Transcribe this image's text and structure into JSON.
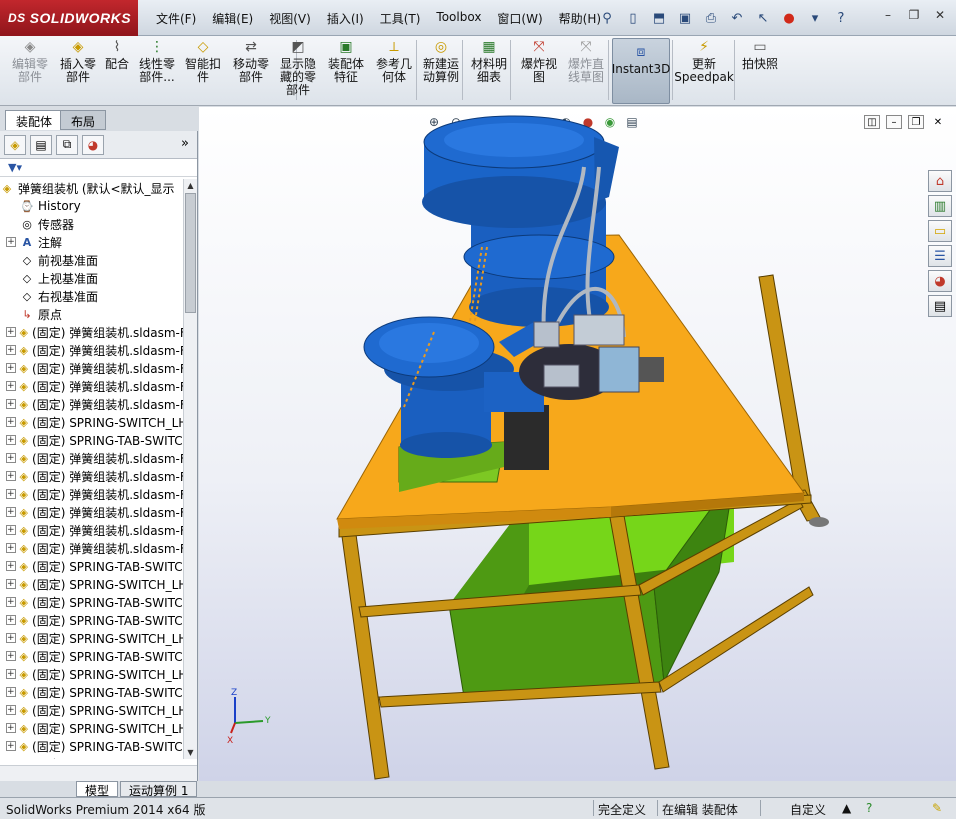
{
  "app": {
    "logo_prefix": "DS",
    "logo": "SOLIDWORKS"
  },
  "menu": [
    "文件(F)",
    "编辑(E)",
    "视图(V)",
    "插入(I)",
    "工具(T)",
    "Toolbox",
    "窗口(W)",
    "帮助(H)"
  ],
  "quick_toolbar": [
    "pin-icon",
    "new-document-icon",
    "open-folder-icon",
    "save-icon",
    "print-icon",
    "undo-icon",
    "select-arrow-icon",
    "rebuild-traffic-light-icon",
    "options-gear-icon",
    "help-icon"
  ],
  "window_controls": [
    "minimize-icon",
    "restore-icon",
    "close-icon"
  ],
  "ribbon": [
    {
      "id": "edit-component",
      "label": "编辑零\n部件",
      "enabled": false
    },
    {
      "id": "insert-component",
      "label": "插入零\n部件",
      "enabled": true
    },
    {
      "id": "mate",
      "label": "配合",
      "enabled": true
    },
    {
      "id": "linear-pattern",
      "label": "线性零\n部件...",
      "enabled": true
    },
    {
      "id": "smart-fasteners",
      "label": "智能扣\n件",
      "enabled": true
    },
    {
      "id": "move-component",
      "label": "移动零\n部件",
      "enabled": true
    },
    {
      "id": "show-hidden",
      "label": "显示隐\n藏的零\n部件",
      "enabled": true
    },
    {
      "id": "assembly-features",
      "label": "装配体\n特征",
      "enabled": true
    },
    {
      "id": "reference-geometry",
      "label": "参考几\n何体",
      "enabled": true
    },
    {
      "id": "new-motion-study",
      "label": "新建运\n动算例",
      "enabled": true
    },
    {
      "id": "bom",
      "label": "材料明\n细表",
      "enabled": true
    },
    {
      "id": "exploded-view",
      "label": "爆炸视\n图",
      "enabled": true
    },
    {
      "id": "explode-line-sketch",
      "label": "爆炸直\n线草图",
      "enabled": false
    },
    {
      "id": "instant3d",
      "label": "Instant3D",
      "enabled": true
    },
    {
      "id": "update-speedpak",
      "label": "更新\nSpeedpak",
      "enabled": true
    },
    {
      "id": "snapshot",
      "label": "拍快照",
      "enabled": true
    }
  ],
  "fm_tabs": {
    "assembly": "装配体",
    "layout": "布局"
  },
  "tree": {
    "root": "弹簧组装机 (默认<默认_显示",
    "items": [
      {
        "label": "History",
        "icon": "history-icon",
        "expand": false
      },
      {
        "label": "传感器",
        "icon": "sensor-icon",
        "expand": false
      },
      {
        "label": "注解",
        "icon": "annotation-icon",
        "expand": true
      },
      {
        "label": "前视基准面",
        "icon": "plane-icon",
        "expand": false
      },
      {
        "label": "上视基准面",
        "icon": "plane-icon",
        "expand": false
      },
      {
        "label": "右视基准面",
        "icon": "plane-icon",
        "expand": false
      },
      {
        "label": "原点",
        "icon": "origin-icon",
        "expand": false
      },
      {
        "label": "(固定) 弹簧组装机.sldasm-F",
        "icon": "subassembly-icon",
        "expand": true
      },
      {
        "label": "(固定) 弹簧组装机.sldasm-F",
        "icon": "subassembly-icon",
        "expand": true
      },
      {
        "label": "(固定) 弹簧组装机.sldasm-F",
        "icon": "subassembly-icon",
        "expand": true
      },
      {
        "label": "(固定) 弹簧组装机.sldasm-F",
        "icon": "subassembly-icon",
        "expand": true
      },
      {
        "label": "(固定) 弹簧组装机.sldasm-F",
        "icon": "subassembly-icon",
        "expand": true
      },
      {
        "label": "(固定) SPRING-SWITCH_LH_",
        "icon": "subassembly-icon",
        "expand": true
      },
      {
        "label": "(固定) SPRING-TAB-SWITCH",
        "icon": "subassembly-icon",
        "expand": true
      },
      {
        "label": "(固定) 弹簧组装机.sldasm-F",
        "icon": "subassembly-icon",
        "expand": true
      },
      {
        "label": "(固定) 弹簧组装机.sldasm-F",
        "icon": "subassembly-icon",
        "expand": true
      },
      {
        "label": "(固定) 弹簧组装机.sldasm-F",
        "icon": "subassembly-icon",
        "expand": true
      },
      {
        "label": "(固定) 弹簧组装机.sldasm-F",
        "icon": "subassembly-icon",
        "expand": true
      },
      {
        "label": "(固定) 弹簧组装机.sldasm-F",
        "icon": "subassembly-icon",
        "expand": true
      },
      {
        "label": "(固定) 弹簧组装机.sldasm-F",
        "icon": "subassembly-icon",
        "expand": true
      },
      {
        "label": "(固定) SPRING-TAB-SWITCH",
        "icon": "subassembly-icon",
        "expand": true
      },
      {
        "label": "(固定) SPRING-SWITCH_LH_",
        "icon": "subassembly-icon",
        "expand": true
      },
      {
        "label": "(固定) SPRING-TAB-SWITCH",
        "icon": "subassembly-icon",
        "expand": true
      },
      {
        "label": "(固定) SPRING-TAB-SWITCH",
        "icon": "subassembly-icon",
        "expand": true
      },
      {
        "label": "(固定) SPRING-SWITCH_LH_",
        "icon": "subassembly-icon",
        "expand": true
      },
      {
        "label": "(固定) SPRING-TAB-SWITCH",
        "icon": "subassembly-icon",
        "expand": true
      },
      {
        "label": "(固定) SPRING-SWITCH_LH_",
        "icon": "subassembly-icon",
        "expand": true
      },
      {
        "label": "(固定) SPRING-TAB-SWITCH",
        "icon": "subassembly-icon",
        "expand": true
      },
      {
        "label": "(固定) SPRING-SWITCH_LH_",
        "icon": "subassembly-icon",
        "expand": true
      },
      {
        "label": "(固定) SPRING-SWITCH_LH_",
        "icon": "subassembly-icon",
        "expand": true
      },
      {
        "label": "(固定) SPRING-TAB-SWITCH",
        "icon": "subassembly-icon",
        "expand": true
      },
      {
        "label": "(固定) SPRING-TAB-SWITCH",
        "icon": "subassembly-icon",
        "expand": true
      }
    ]
  },
  "bottom_tabs": {
    "model": "模型",
    "motion": "运动算例 1"
  },
  "status": {
    "product": "SolidWorks Premium 2014 x64 版",
    "definition": "完全定义",
    "editing": "在编辑 装配体",
    "units": "自定义"
  },
  "triad": {
    "x": "X",
    "y": "Y",
    "z": "Z"
  },
  "colors": {
    "table_top": "#f7a81b",
    "frame": "#b8860b",
    "hopper": "#1a64c8",
    "bin": "#4e9a13",
    "bin_inner": "#76d619",
    "base_block": "#7dc823"
  }
}
